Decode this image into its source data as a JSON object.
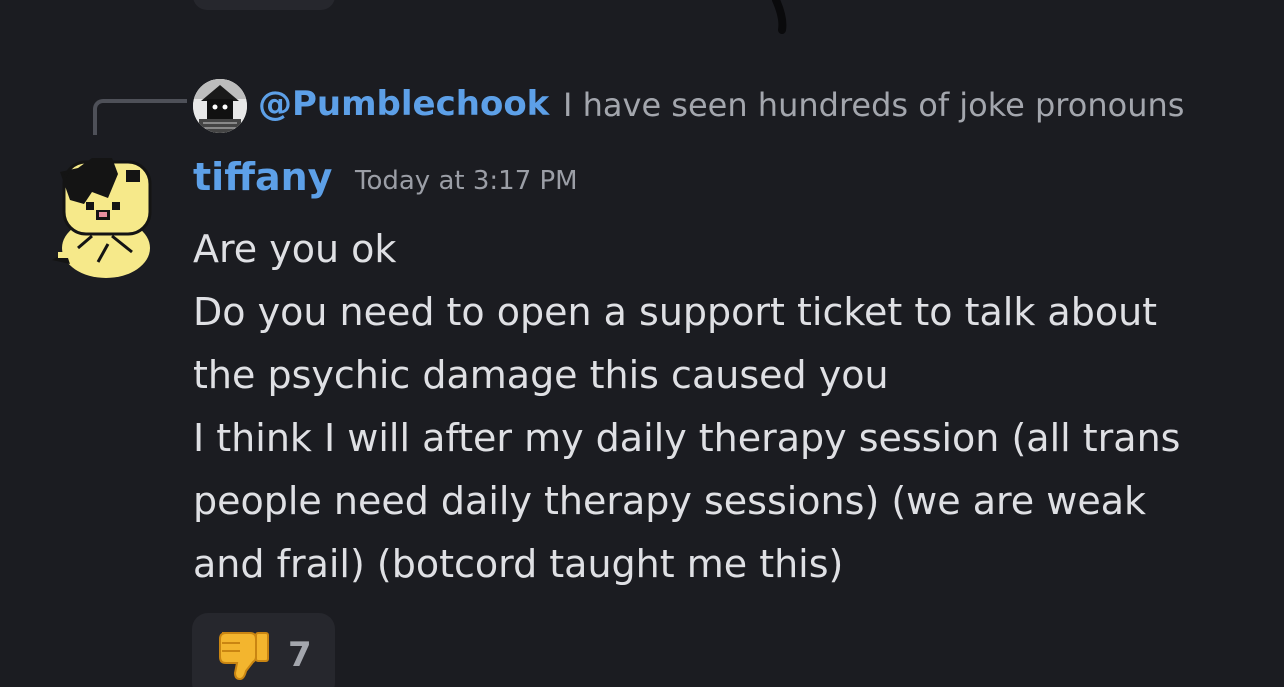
{
  "reply": {
    "author": "@Pumblechook",
    "preview": "I have seen hundreds of joke pronouns"
  },
  "message": {
    "author": "tiffany",
    "timestamp": "Today at 3:17 PM",
    "lines": [
      "Are you ok",
      "Do you need to open a support ticket to talk about",
      "the psychic damage this caused you",
      "I think I will after my daily therapy session (all trans",
      "people need daily therapy sessions) (we are weak",
      "and frail) (botcord taught me this)"
    ]
  },
  "reaction": {
    "emoji": "thumbs-down-icon",
    "count": "7"
  },
  "colors": {
    "background": "#1b1c21",
    "username": "#5da0e8",
    "pill": "#26272d"
  }
}
